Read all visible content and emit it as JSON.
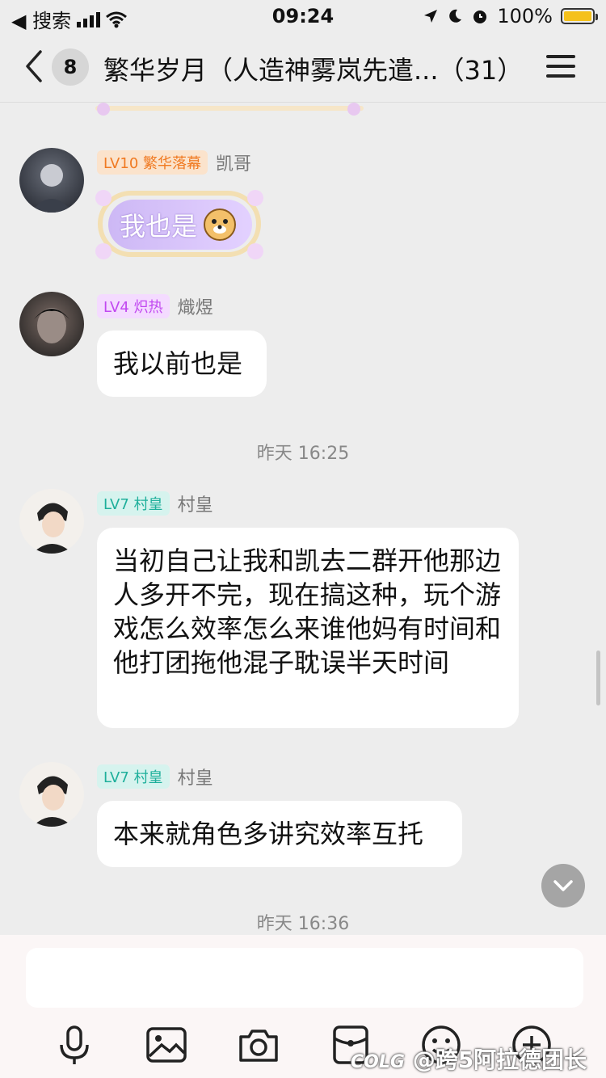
{
  "status_bar": {
    "back_app": "◀ 搜索",
    "time": "09:24",
    "battery": "100%"
  },
  "header": {
    "unread_count": "8",
    "title": "繁华岁月（人造神雾岚先遣...（31）"
  },
  "messages": [
    {
      "level": "LV10",
      "title": "繁华落幕",
      "level_color": "orange",
      "name": "凯哥",
      "text": "我也是",
      "style": "fancy"
    },
    {
      "level": "LV4",
      "title": "炽热",
      "level_color": "purple",
      "name": "熾煜",
      "text": "我以前也是"
    },
    {
      "timestamp": "昨天 16:25"
    },
    {
      "level": "LV7",
      "title": "村皇",
      "level_color": "teal",
      "name": "村皇",
      "text": "当初自己让我和凯去二群开他那边人多开不完，现在搞这种，玩个游戏怎么效率怎么来谁他妈有时间和他打团拖他混子耽误半天时间"
    },
    {
      "level": "LV7",
      "title": "村皇",
      "level_color": "teal",
      "name": "村皇",
      "text": "本来就角色多讲究效率互托"
    },
    {
      "timestamp": "昨天 16:36"
    }
  ],
  "input": {
    "placeholder": ""
  },
  "toolbar": {
    "icons": [
      "microphone-icon",
      "image-icon",
      "camera-icon",
      "red-packet-icon",
      "emoji-icon",
      "plus-icon"
    ]
  },
  "watermark": "@跨5阿拉德团长"
}
